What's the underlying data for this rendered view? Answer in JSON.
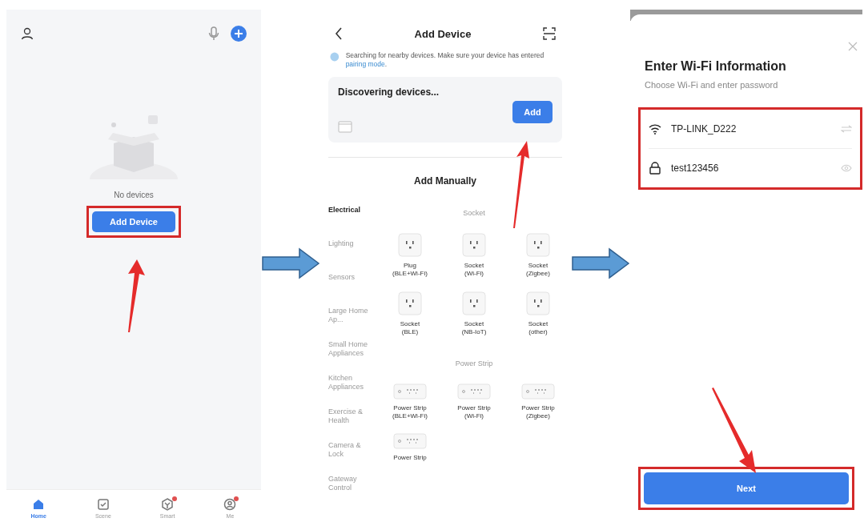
{
  "home_screen": {
    "empty_text": "No devices",
    "add_button": "Add Device",
    "tabs": [
      {
        "label": "Home",
        "selected": true,
        "badge": false,
        "kind": "home"
      },
      {
        "label": "Scene",
        "selected": false,
        "badge": false,
        "kind": "scene"
      },
      {
        "label": "Smart",
        "selected": false,
        "badge": true,
        "kind": "smart"
      },
      {
        "label": "Me",
        "selected": false,
        "badge": true,
        "kind": "me"
      }
    ]
  },
  "add_device_screen": {
    "title": "Add Device",
    "notice": "Searching for nearby devices. Make sure your device has entered ",
    "notice_link": "pairing mode",
    "notice_end": ".",
    "discover_title": "Discovering devices...",
    "add_button": "Add",
    "section_title": "Add Manually",
    "categories": [
      {
        "label": "Electrical",
        "selected": true
      },
      {
        "label": "Lighting",
        "selected": false
      },
      {
        "label": "Sensors",
        "selected": false
      },
      {
        "label": "Large Home Ap...",
        "selected": false
      },
      {
        "label": "Small Home Appliances",
        "selected": false
      },
      {
        "label": "Kitchen Appliances",
        "selected": false
      },
      {
        "label": "Exercise & Health",
        "selected": false
      },
      {
        "label": "Camera & Lock",
        "selected": false
      },
      {
        "label": "Gateway Control",
        "selected": false
      }
    ],
    "groups": [
      {
        "title": "Socket",
        "items": [
          {
            "kind": "socket",
            "name": "Plug",
            "variant": "(BLE+Wi-Fi)"
          },
          {
            "kind": "socket",
            "name": "Socket",
            "variant": "(Wi-Fi)"
          },
          {
            "kind": "socket",
            "name": "Socket",
            "variant": "(Zigbee)"
          },
          {
            "kind": "socket",
            "name": "Socket",
            "variant": "(BLE)"
          },
          {
            "kind": "socket",
            "name": "Socket",
            "variant": "(NB-IoT)"
          },
          {
            "kind": "socket",
            "name": "Socket",
            "variant": "(other)"
          }
        ]
      },
      {
        "title": "Power Strip",
        "items": [
          {
            "kind": "strip",
            "name": "Power Strip",
            "variant": "(BLE+Wi-Fi)"
          },
          {
            "kind": "strip",
            "name": "Power Strip",
            "variant": "(Wi-Fi)"
          },
          {
            "kind": "strip",
            "name": "Power Strip",
            "variant": "(Zigbee)"
          },
          {
            "kind": "strip",
            "name": "Power Strip"
          }
        ]
      }
    ]
  },
  "wifi_screen": {
    "title": "Enter Wi-Fi Information",
    "subtitle": "Choose Wi-Fi and enter password",
    "network": "TP-LINK_D222",
    "password": "test123456",
    "next_button": "Next"
  }
}
